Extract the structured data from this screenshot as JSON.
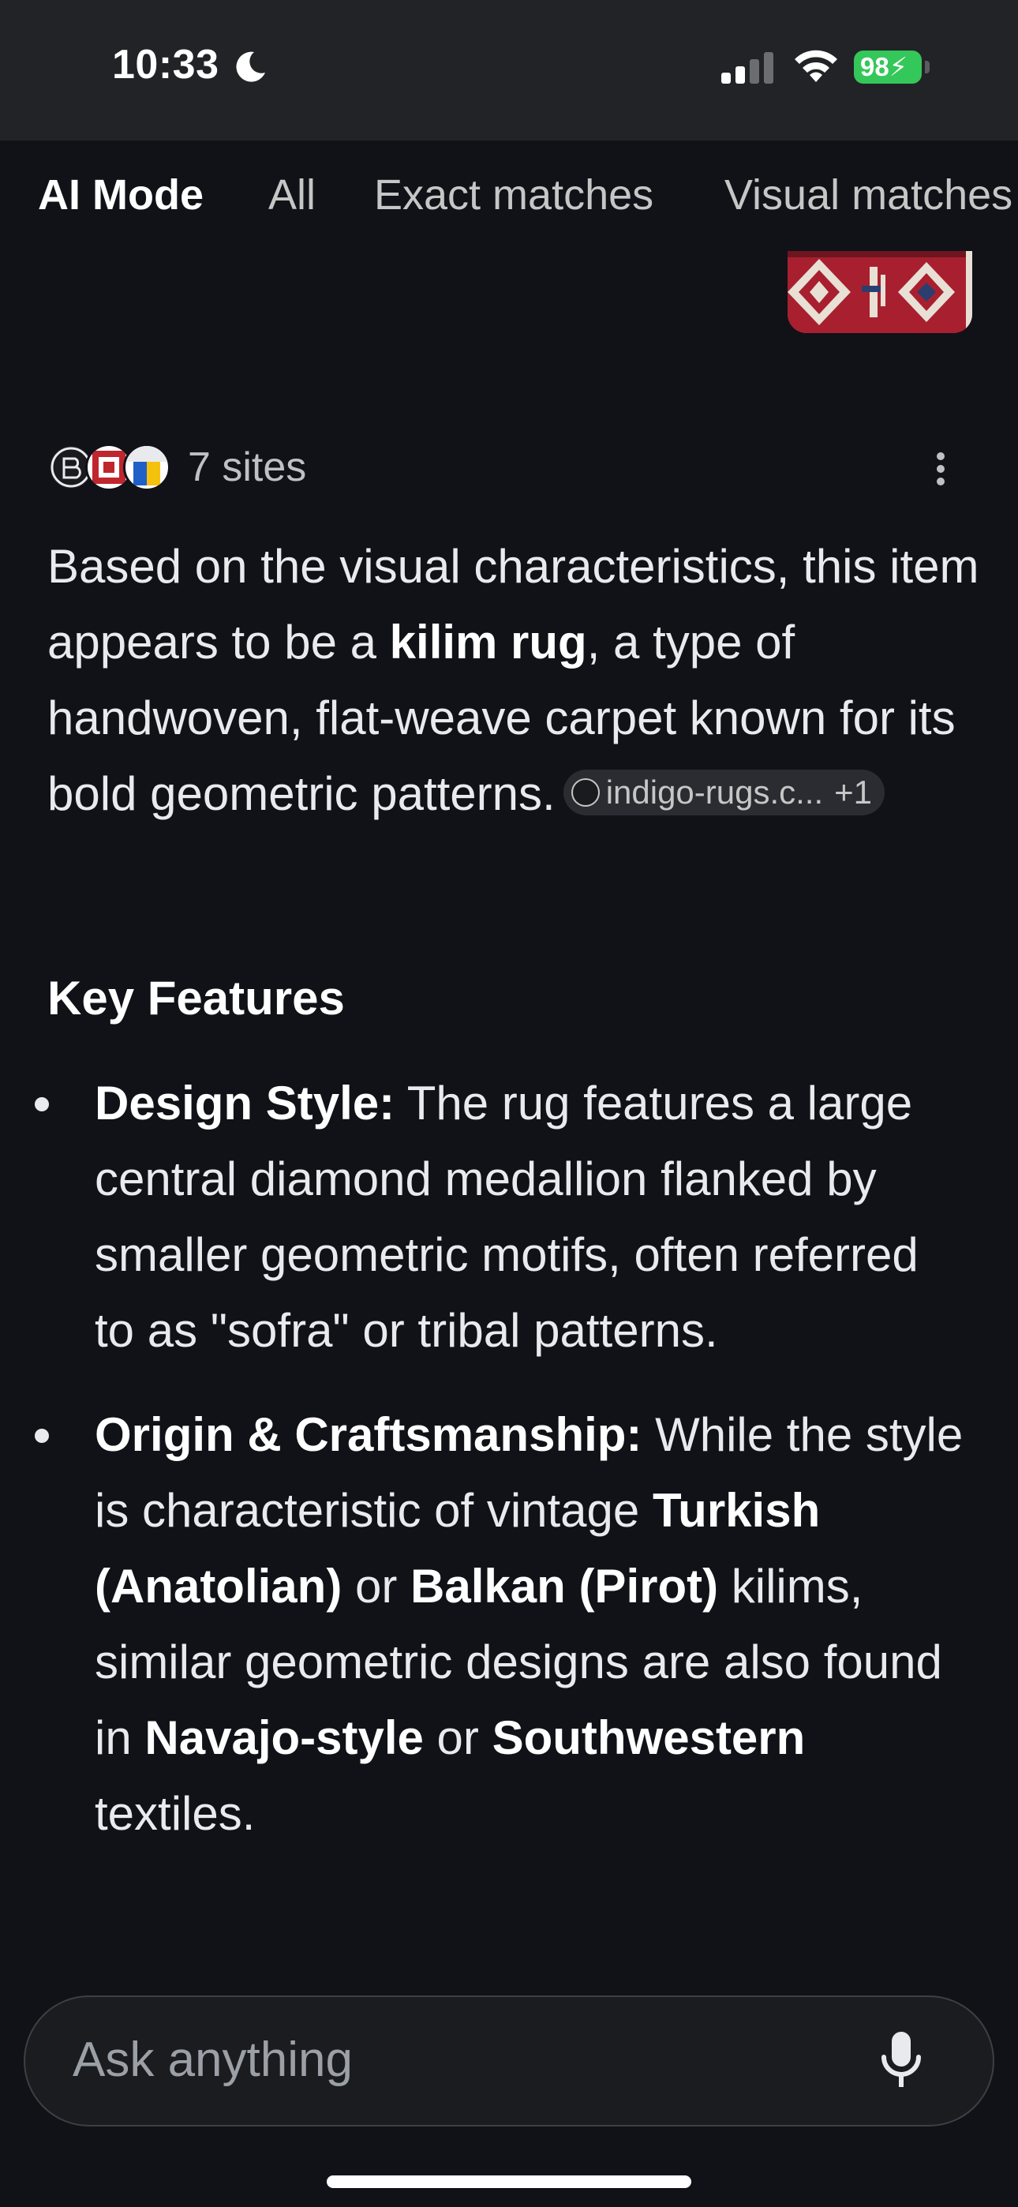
{
  "status_bar": {
    "time": "10:33",
    "battery": "98",
    "battery_color": "#34c759"
  },
  "tabs": [
    {
      "label": "AI Mode",
      "active": true
    },
    {
      "label": "All",
      "active": false
    },
    {
      "label": "Exact matches",
      "active": false
    },
    {
      "label": "Visual matches",
      "active": false
    }
  ],
  "sources": {
    "label": "7 sites"
  },
  "answer": {
    "text_1": "Based on the visual characteristics, this item appears to be a ",
    "bold_1": "kilim rug",
    "text_2": ", a type of handwoven, flat-weave carpet known for its bold geometric patterns.",
    "chip_label": "indigo-rugs.c...",
    "chip_extra": "+1"
  },
  "key_features": {
    "heading": "Key Features",
    "items": [
      {
        "title": "Design Style:",
        "text": " The rug features a large central diamond medallion flanked by smaller geometric motifs, often referred to as \"sofra\" or tribal patterns."
      },
      {
        "title": "Origin & Craftsmanship:",
        "t1": " While the style is characteristic of vintage ",
        "b1": "Turkish (Anatolian)",
        "t2": " or ",
        "b2": "Balkan (Pirot)",
        "t3": " kilims, similar geometric designs are also found in ",
        "b3": "Navajo-style",
        "t4": " or ",
        "b4": "Southwestern",
        "t5": " textiles."
      }
    ]
  },
  "search": {
    "placeholder": "Ask anything"
  },
  "icons": {
    "moon": "moon-icon",
    "signal": "signal-icon",
    "wifi": "wifi-icon",
    "more": "more-vert-icon",
    "mic": "mic-icon"
  }
}
